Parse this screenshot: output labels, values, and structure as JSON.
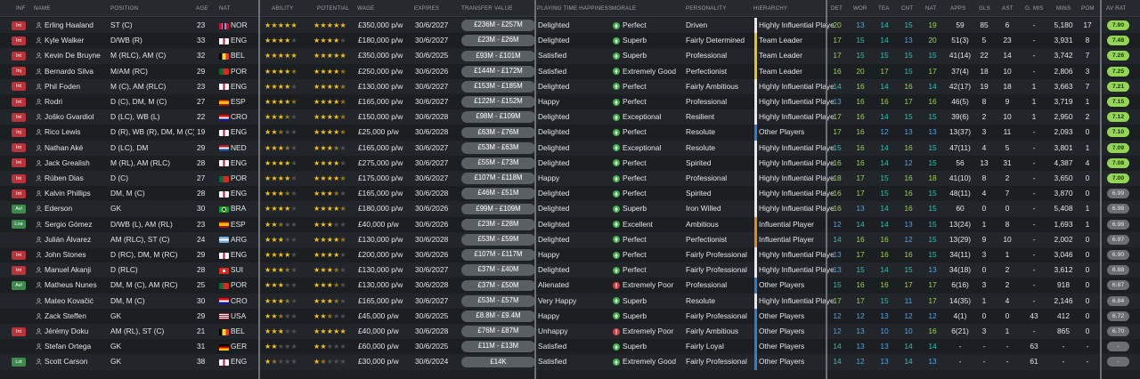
{
  "headers": {
    "inf": "INF",
    "name": "NAME",
    "position": "POSITION",
    "age": "AGE",
    "nat": "NAT",
    "ability": "ABILITY",
    "potential": "POTENTIAL",
    "wage": "WAGE",
    "expires": "EXPIRES",
    "transfer_value": "TRANSFER VALUE",
    "playing_time": "PLAYING TIME HAPPINESS",
    "morale": "MORALE",
    "personality": "PERSONALITY",
    "hierarchy": "HIERARCHY",
    "det": "DET",
    "wor": "WOR",
    "tea": "TEA",
    "cnt": "CNT",
    "nat2": "NAT",
    "apps": "APPS",
    "gls": "GLS",
    "ast": "AST",
    "gmis": "G. MIS",
    "mins": "MINS",
    "pom": "POM",
    "avrat": "AV RAT"
  },
  "colors": {
    "inf_red": "#b8333a",
    "inf_green": "#3d8b4c",
    "star": "#f2c21b",
    "morale_green": "#3fae49",
    "morale_red": "#d23b3b",
    "hier_yellow": "#e6c41a",
    "hier_orange": "#e08a25",
    "hier_blue": "#2d7dd2",
    "hier_white": "#e8e8e8",
    "attr_green": "#9ad24b",
    "attr_teal": "#2ec1b0",
    "attr_blue": "#4da3e8",
    "rating_green": "#93d654"
  },
  "players": [
    {
      "inf": "Int",
      "name": "Erling Haaland",
      "position": "ST (C)",
      "age": "23",
      "nat": "NOR",
      "ability": 5,
      "potential": 5,
      "wage": "£350,000 p/w",
      "expires": "30/6/2027",
      "tv": "£236M - £257M",
      "happy": "Delighted",
      "morale": "Perfect",
      "morale_state": "good",
      "personality": "Driven",
      "hierarchy": "Highly Influential Player",
      "hier": "white",
      "det": "20",
      "wor": "13",
      "tea": "14",
      "cnt": "15",
      "nat2": "19",
      "apps": "59",
      "gls": "85",
      "ast": "6",
      "gmis": "-",
      "mins": "5,180",
      "pom": "17",
      "avr": "7.90",
      "avr_g": true,
      "attrs": [
        "g",
        "b",
        "t",
        "t",
        "g"
      ]
    },
    {
      "inf": "Int",
      "name": "Kyle Walker",
      "position": "D/WB (R)",
      "age": "33",
      "nat": "ENG",
      "ability": 4,
      "potential": 4,
      "wage": "£180,000 p/w",
      "expires": "30/6/2027",
      "tv": "£23M - £26M",
      "happy": "Delighted",
      "morale": "Superb",
      "morale_state": "good",
      "personality": "Fairly Determined",
      "hierarchy": "Team Leader",
      "hier": "yellow",
      "det": "17",
      "wor": "15",
      "tea": "14",
      "cnt": "13",
      "nat2": "20",
      "apps": "51(3)",
      "gls": "5",
      "ast": "23",
      "gmis": "-",
      "mins": "3,931",
      "pom": "8",
      "avr": "7.48",
      "avr_g": true,
      "attrs": [
        "g",
        "t",
        "t",
        "b",
        "g"
      ]
    },
    {
      "inf": "Int",
      "name": "Kevin De Bruyne",
      "position": "M (RLC), AM (C)",
      "age": "32",
      "nat": "BEL",
      "ability": 5,
      "potential": 5,
      "wage": "£350,000 p/w",
      "expires": "30/6/2025",
      "tv": "£93M - £101M",
      "happy": "Satisfied",
      "morale": "Superb",
      "morale_state": "good",
      "personality": "Professional",
      "hierarchy": "Team Leader",
      "hier": "yellow",
      "det": "17",
      "wor": "15",
      "tea": "15",
      "cnt": "15",
      "nat2": "15",
      "apps": "41(14)",
      "gls": "22",
      "ast": "14",
      "gmis": "-",
      "mins": "3,742",
      "pom": "7",
      "avr": "7.26",
      "avr_g": true,
      "attrs": [
        "g",
        "t",
        "t",
        "t",
        "t"
      ]
    },
    {
      "inf": "Inj",
      "name": "Bernardo Silva",
      "position": "M/AM (RC)",
      "age": "29",
      "nat": "POR",
      "ability": 4.5,
      "potential": 4.5,
      "wage": "£250,000 p/w",
      "expires": "30/6/2026",
      "tv": "£144M - £172M",
      "happy": "Satisfied",
      "morale": "Extremely Good",
      "morale_state": "good",
      "personality": "Perfectionist",
      "hierarchy": "Team Leader",
      "hier": "yellow",
      "det": "16",
      "wor": "20",
      "tea": "17",
      "cnt": "15",
      "nat2": "17",
      "apps": "37(4)",
      "gls": "18",
      "ast": "10",
      "gmis": "-",
      "mins": "2,806",
      "pom": "3",
      "avr": "7.25",
      "avr_g": true,
      "attrs": [
        "g",
        "g",
        "g",
        "t",
        "g"
      ]
    },
    {
      "inf": "Int",
      "name": "Phil Foden",
      "position": "M (C), AM (RLC)",
      "age": "23",
      "nat": "ENG",
      "ability": 4,
      "potential": 4.5,
      "wage": "£130,000 p/w",
      "expires": "30/6/2027",
      "tv": "£153M - £185M",
      "happy": "Delighted",
      "morale": "Perfect",
      "morale_state": "good",
      "personality": "Fairly Ambitious",
      "hierarchy": "Highly Influential Player",
      "hier": "white",
      "det": "14",
      "wor": "16",
      "tea": "14",
      "cnt": "16",
      "nat2": "14",
      "apps": "42(17)",
      "gls": "19",
      "ast": "18",
      "gmis": "1",
      "mins": "3,663",
      "pom": "7",
      "avr": "7.21",
      "avr_g": true,
      "attrs": [
        "t",
        "g",
        "t",
        "g",
        "t"
      ]
    },
    {
      "inf": "Int",
      "name": "Rodri",
      "position": "D (C), DM, M (C)",
      "age": "27",
      "nat": "ESP",
      "ability": 4.5,
      "potential": 4.5,
      "wage": "£165,000 p/w",
      "expires": "30/6/2027",
      "tv": "£122M - £152M",
      "happy": "Happy",
      "morale": "Perfect",
      "morale_state": "good",
      "personality": "Professional",
      "hierarchy": "Highly Influential Player",
      "hier": "white",
      "det": "13",
      "wor": "16",
      "tea": "16",
      "cnt": "17",
      "nat2": "16",
      "apps": "46(5)",
      "gls": "8",
      "ast": "9",
      "gmis": "1",
      "mins": "3,719",
      "pom": "1",
      "avr": "7.15",
      "avr_g": true,
      "attrs": [
        "b",
        "g",
        "g",
        "g",
        "g"
      ]
    },
    {
      "inf": "Int",
      "name": "Joško Gvardiol",
      "position": "D (LC), WB (L)",
      "age": "22",
      "nat": "CRO",
      "ability": 3.5,
      "potential": 4.5,
      "wage": "£150,000 p/w",
      "expires": "30/6/2028",
      "tv": "£98M - £109M",
      "happy": "Delighted",
      "morale": "Exceptional",
      "morale_state": "good",
      "personality": "Resilient",
      "hierarchy": "Highly Influential Player",
      "hier": "white",
      "det": "17",
      "wor": "16",
      "tea": "14",
      "cnt": "15",
      "nat2": "15",
      "apps": "39(6)",
      "gls": "2",
      "ast": "10",
      "gmis": "1",
      "mins": "2,950",
      "pom": "2",
      "avr": "7.12",
      "avr_g": true,
      "attrs": [
        "g",
        "g",
        "t",
        "t",
        "t"
      ]
    },
    {
      "inf": "Inj",
      "name": "Rico Lewis",
      "position": "D (R), WB (R), DM, M (C)",
      "age": "19",
      "nat": "ENG",
      "ability": 2.5,
      "potential": 4.5,
      "wage": "£25,000 p/w",
      "expires": "30/6/2028",
      "tv": "£63M - £76M",
      "happy": "Delighted",
      "morale": "Perfect",
      "morale_state": "good",
      "personality": "Resolute",
      "hierarchy": "Other Players",
      "hier": "blue",
      "det": "17",
      "wor": "16",
      "tea": "12",
      "cnt": "13",
      "nat2": "13",
      "apps": "13(37)",
      "gls": "3",
      "ast": "11",
      "gmis": "-",
      "mins": "2,093",
      "pom": "0",
      "avr": "7.10",
      "avr_g": true,
      "attrs": [
        "g",
        "g",
        "b",
        "b",
        "b"
      ]
    },
    {
      "inf": "Int",
      "name": "Nathan Aké",
      "position": "D (LC), DM",
      "age": "29",
      "nat": "NED",
      "ability": 3.5,
      "potential": 3.5,
      "wage": "£165,000 p/w",
      "expires": "30/6/2027",
      "tv": "£53M - £63M",
      "happy": "Delighted",
      "morale": "Exceptional",
      "morale_state": "good",
      "personality": "Resolute",
      "hierarchy": "Highly Influential Player",
      "hier": "white",
      "det": "15",
      "wor": "16",
      "tea": "14",
      "cnt": "16",
      "nat2": "15",
      "apps": "47(11)",
      "gls": "4",
      "ast": "5",
      "gmis": "-",
      "mins": "3,801",
      "pom": "1",
      "avr": "7.09",
      "avr_g": true,
      "attrs": [
        "t",
        "g",
        "t",
        "g",
        "t"
      ]
    },
    {
      "inf": "Int",
      "name": "Jack Grealish",
      "position": "M (RL), AM (RLC)",
      "age": "28",
      "nat": "ENG",
      "ability": 4,
      "potential": 4,
      "wage": "£275,000 p/w",
      "expires": "30/6/2027",
      "tv": "£55M - £73M",
      "happy": "Delighted",
      "morale": "Perfect",
      "morale_state": "good",
      "personality": "Spirited",
      "hierarchy": "Highly Influential Player",
      "hier": "white",
      "det": "16",
      "wor": "16",
      "tea": "14",
      "cnt": "12",
      "nat2": "15",
      "apps": "56",
      "gls": "13",
      "ast": "31",
      "gmis": "-",
      "mins": "4,387",
      "pom": "4",
      "avr": "7.08",
      "avr_g": true,
      "attrs": [
        "g",
        "g",
        "t",
        "b",
        "t"
      ]
    },
    {
      "inf": "Int",
      "name": "Rúben Dias",
      "position": "D (C)",
      "age": "27",
      "nat": "POR",
      "ability": 4,
      "potential": 4.5,
      "wage": "£175,000 p/w",
      "expires": "30/6/2027",
      "tv": "£107M - £118M",
      "happy": "Happy",
      "morale": "Perfect",
      "morale_state": "good",
      "personality": "Professional",
      "hierarchy": "Highly Influential Player",
      "hier": "white",
      "det": "18",
      "wor": "17",
      "tea": "15",
      "cnt": "16",
      "nat2": "18",
      "apps": "41(10)",
      "gls": "8",
      "ast": "2",
      "gmis": "-",
      "mins": "3,650",
      "pom": "0",
      "avr": "7.00",
      "avr_g": true,
      "attrs": [
        "g",
        "g",
        "t",
        "g",
        "g"
      ]
    },
    {
      "inf": "Int",
      "name": "Kalvin Phillips",
      "position": "DM, M (C)",
      "age": "28",
      "nat": "ENG",
      "ability": 3.5,
      "potential": 3.5,
      "wage": "£165,000 p/w",
      "expires": "30/6/2028",
      "tv": "£46M - £51M",
      "happy": "Delighted",
      "morale": "Perfect",
      "morale_state": "good",
      "personality": "Spirited",
      "hierarchy": "Highly Influential Player",
      "hier": "white",
      "det": "16",
      "wor": "17",
      "tea": "15",
      "cnt": "16",
      "nat2": "15",
      "apps": "48(11)",
      "gls": "4",
      "ast": "7",
      "gmis": "-",
      "mins": "3,870",
      "pom": "0",
      "avr": "6.99",
      "avr_g": false,
      "attrs": [
        "g",
        "g",
        "t",
        "g",
        "t"
      ]
    },
    {
      "inf": "Avl",
      "name": "Ederson",
      "position": "GK",
      "age": "30",
      "nat": "BRA",
      "ability": 4,
      "potential": 4.5,
      "wage": "£180,000 p/w",
      "expires": "30/6/2026",
      "tv": "£99M - £109M",
      "happy": "Delighted",
      "morale": "Superb",
      "morale_state": "good",
      "personality": "Iron Willed",
      "hierarchy": "Highly Influential Player",
      "hier": "white",
      "det": "16",
      "wor": "13",
      "tea": "14",
      "cnt": "16",
      "nat2": "15",
      "apps": "60",
      "gls": "0",
      "ast": "0",
      "gmis": "-",
      "mins": "5,408",
      "pom": "1",
      "avr": "6.98",
      "avr_g": false,
      "attrs": [
        "g",
        "b",
        "t",
        "g",
        "t"
      ]
    },
    {
      "inf": "Loa",
      "name": "Sergio Gómez",
      "position": "D/WB (L), AM (RL)",
      "age": "23",
      "nat": "ESP",
      "ability": 2.5,
      "potential": 3,
      "wage": "£40,000 p/w",
      "expires": "30/6/2026",
      "tv": "£23M - £28M",
      "happy": "Delighted",
      "morale": "Excellent",
      "morale_state": "good",
      "personality": "Ambitious",
      "hierarchy": "Influential Player",
      "hier": "orange",
      "det": "12",
      "wor": "14",
      "tea": "14",
      "cnt": "13",
      "nat2": "15",
      "apps": "13(24)",
      "gls": "1",
      "ast": "8",
      "gmis": "-",
      "mins": "1,693",
      "pom": "1",
      "avr": "6.98",
      "avr_g": false,
      "attrs": [
        "b",
        "t",
        "t",
        "b",
        "t"
      ]
    },
    {
      "inf": "",
      "name": "Julián Álvarez",
      "position": "AM (RLC), ST (C)",
      "age": "24",
      "nat": "ARG",
      "ability": 3,
      "potential": 4.5,
      "wage": "£130,000 p/w",
      "expires": "30/6/2028",
      "tv": "£53M - £59M",
      "happy": "Delighted",
      "morale": "Perfect",
      "morale_state": "good",
      "personality": "Perfectionist",
      "hierarchy": "Influential Player",
      "hier": "orange",
      "det": "14",
      "wor": "16",
      "tea": "16",
      "cnt": "12",
      "nat2": "15",
      "apps": "13(29)",
      "gls": "9",
      "ast": "10",
      "gmis": "-",
      "mins": "2,002",
      "pom": "0",
      "avr": "6.97",
      "avr_g": false,
      "attrs": [
        "t",
        "g",
        "g",
        "b",
        "t"
      ]
    },
    {
      "inf": "Int",
      "name": "John Stones",
      "position": "D (RC), DM, M (RC)",
      "age": "29",
      "nat": "ENG",
      "ability": 4,
      "potential": 4,
      "wage": "£200,000 p/w",
      "expires": "30/6/2026",
      "tv": "£107M - £117M",
      "happy": "Happy",
      "morale": "Perfect",
      "morale_state": "good",
      "personality": "Fairly Professional",
      "hierarchy": "Highly Influential Player",
      "hier": "white",
      "det": "13",
      "wor": "17",
      "tea": "16",
      "cnt": "16",
      "nat2": "15",
      "apps": "34(11)",
      "gls": "3",
      "ast": "1",
      "gmis": "-",
      "mins": "3,046",
      "pom": "0",
      "avr": "6.90",
      "avr_g": false,
      "attrs": [
        "b",
        "g",
        "g",
        "g",
        "t"
      ]
    },
    {
      "inf": "Int",
      "name": "Manuel Akanji",
      "position": "D (RLC)",
      "age": "28",
      "nat": "SUI",
      "ability": 3.5,
      "potential": 3.5,
      "wage": "£130,000 p/w",
      "expires": "30/6/2027",
      "tv": "£37M - £40M",
      "happy": "Delighted",
      "morale": "Perfect",
      "morale_state": "good",
      "personality": "Fairly Professional",
      "hierarchy": "Highly Influential Player",
      "hier": "white",
      "det": "13",
      "wor": "15",
      "tea": "14",
      "cnt": "15",
      "nat2": "13",
      "apps": "34(18)",
      "gls": "0",
      "ast": "2",
      "gmis": "-",
      "mins": "3,612",
      "pom": "0",
      "avr": "6.88",
      "avr_g": false,
      "attrs": [
        "b",
        "t",
        "t",
        "t",
        "b"
      ]
    },
    {
      "inf": "Avl",
      "name": "Matheus Nunes",
      "position": "DM, M (C), AM (RC)",
      "age": "25",
      "nat": "POR",
      "ability": 3,
      "potential": 3.5,
      "wage": "£130,000 p/w",
      "expires": "30/6/2028",
      "tv": "£37M - £50M",
      "happy": "Alienated",
      "morale": "Extremely Poor",
      "morale_state": "bad",
      "personality": "Professional",
      "hierarchy": "Other Players",
      "hier": "blue",
      "det": "15",
      "wor": "16",
      "tea": "16",
      "cnt": "17",
      "nat2": "17",
      "apps": "6(16)",
      "gls": "3",
      "ast": "2",
      "gmis": "-",
      "mins": "918",
      "pom": "0",
      "avr": "6.87",
      "avr_g": false,
      "attrs": [
        "t",
        "g",
        "g",
        "g",
        "g"
      ]
    },
    {
      "inf": "",
      "name": "Mateo Kovačić",
      "position": "DM, M (C)",
      "age": "30",
      "nat": "CRO",
      "ability": 3.5,
      "potential": 3.5,
      "wage": "£165,000 p/w",
      "expires": "30/6/2027",
      "tv": "£53M - £57M",
      "happy": "Very Happy",
      "morale": "Superb",
      "morale_state": "good",
      "personality": "Resolute",
      "hierarchy": "Highly Influential Player",
      "hier": "white",
      "det": "17",
      "wor": "17",
      "tea": "15",
      "cnt": "11",
      "nat2": "17",
      "apps": "14(35)",
      "gls": "1",
      "ast": "4",
      "gmis": "-",
      "mins": "2,146",
      "pom": "0",
      "avr": "6.84",
      "avr_g": false,
      "attrs": [
        "g",
        "g",
        "t",
        "b",
        "g"
      ]
    },
    {
      "inf": "",
      "name": "Zack Steffen",
      "position": "GK",
      "age": "29",
      "nat": "USA",
      "ability": 2.5,
      "potential": 2.5,
      "wage": "£45,000 p/w",
      "expires": "30/6/2025",
      "tv": "£8.8M - £9.4M",
      "happy": "Happy",
      "morale": "Superb",
      "morale_state": "good",
      "personality": "Fairly Professional",
      "hierarchy": "Other Players",
      "hier": "blue",
      "det": "12",
      "wor": "12",
      "tea": "13",
      "cnt": "12",
      "nat2": "12",
      "apps": "4(1)",
      "gls": "0",
      "ast": "0",
      "gmis": "43",
      "mins": "412",
      "pom": "0",
      "avr": "6.72",
      "avr_g": false,
      "attrs": [
        "b",
        "b",
        "b",
        "b",
        "b"
      ]
    },
    {
      "inf": "Int",
      "name": "Jérémy Doku",
      "position": "AM (RL), ST (C)",
      "age": "21",
      "nat": "BEL",
      "ability": 3,
      "potential": 5,
      "wage": "£40,000 p/w",
      "expires": "30/6/2028",
      "tv": "£76M - £87M",
      "happy": "Unhappy",
      "morale": "Extremely Poor",
      "morale_state": "bad",
      "personality": "Fairly Ambitious",
      "hierarchy": "Other Players",
      "hier": "blue",
      "det": "12",
      "wor": "13",
      "tea": "10",
      "cnt": "10",
      "nat2": "16",
      "apps": "6(21)",
      "gls": "3",
      "ast": "1",
      "gmis": "-",
      "mins": "865",
      "pom": "0",
      "avr": "6.70",
      "avr_g": false,
      "attrs": [
        "b",
        "b",
        "b",
        "b",
        "g"
      ]
    },
    {
      "inf": "",
      "name": "Stefan Ortega",
      "position": "GK",
      "age": "31",
      "nat": "GER",
      "ability": 2,
      "potential": 2,
      "wage": "£60,000 p/w",
      "expires": "30/6/2025",
      "tv": "£11M - £13M",
      "happy": "Satisfied",
      "morale": "Superb",
      "morale_state": "good",
      "personality": "Fairly Loyal",
      "hierarchy": "Other Players",
      "hier": "blue",
      "det": "14",
      "wor": "13",
      "tea": "13",
      "cnt": "14",
      "nat2": "14",
      "apps": "-",
      "gls": "-",
      "ast": "-",
      "gmis": "63",
      "mins": "-",
      "pom": "-",
      "avr": "-",
      "avr_g": false,
      "attrs": [
        "t",
        "b",
        "b",
        "t",
        "t"
      ]
    },
    {
      "inf": "Lst",
      "name": "Scott Carson",
      "position": "GK",
      "age": "38",
      "nat": "ENG",
      "ability": 1.5,
      "potential": 1.5,
      "wage": "£30,000 p/w",
      "expires": "30/6/2024",
      "tv": "£14K",
      "happy": "Satisfied",
      "morale": "Extremely Good",
      "morale_state": "good",
      "personality": "Fairly Professional",
      "hierarchy": "Other Players",
      "hier": "blue",
      "det": "14",
      "wor": "12",
      "tea": "13",
      "cnt": "14",
      "nat2": "13",
      "apps": "-",
      "gls": "-",
      "ast": "-",
      "gmis": "61",
      "mins": "-",
      "pom": "-",
      "avr": "-",
      "avr_g": false,
      "attrs": [
        "t",
        "b",
        "b",
        "t",
        "b"
      ]
    }
  ]
}
